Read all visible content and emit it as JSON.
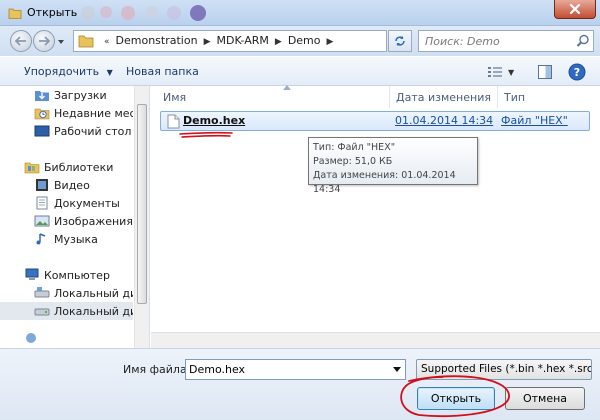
{
  "window": {
    "title": "Открыть"
  },
  "address": {
    "crumbs": [
      "Demonstration",
      "MDK-ARM",
      "Demo"
    ],
    "search_placeholder": "Поиск: Demo"
  },
  "toolbar": {
    "organize_label": "Упорядочить",
    "new_folder_label": "Новая папка"
  },
  "sidebar": {
    "items": [
      {
        "label": "Загрузки",
        "icon": "downloads-icon"
      },
      {
        "label": "Недавние места",
        "icon": "recent-places-icon"
      },
      {
        "label": "Рабочий стол",
        "icon": "desktop-icon"
      },
      {
        "label": "Библиотеки",
        "icon": "libraries-icon"
      },
      {
        "label": "Видео",
        "icon": "video-icon"
      },
      {
        "label": "Документы",
        "icon": "documents-icon"
      },
      {
        "label": "Изображения",
        "icon": "pictures-icon"
      },
      {
        "label": "Музыка",
        "icon": "music-icon"
      },
      {
        "label": "Компьютер",
        "icon": "computer-icon"
      },
      {
        "label": "Локальный диск",
        "icon": "drive-icon"
      },
      {
        "label": "Локальный диск",
        "icon": "drive-icon",
        "selected": true
      }
    ]
  },
  "file_list": {
    "columns": [
      "Имя",
      "Дата изменения",
      "Тип"
    ],
    "files": [
      {
        "name": "Demo.hex",
        "date": "01.04.2014 14:34",
        "type": "Файл \"HEX\""
      }
    ],
    "tooltip": {
      "type": "Тип: Файл \"HEX\"",
      "size": "Размер: 51,0 КБ",
      "date": "Дата изменения: 01.04.2014 14:34"
    }
  },
  "bottom": {
    "filename_label": "Имя файла:",
    "filename_value": "Demo.hex",
    "filter_label": "Supported Files (*.bin *.hex *.src",
    "open_label": "Открыть",
    "cancel_label": "Отмена"
  },
  "colors": {
    "annotation_red": "#d0101a",
    "selection_border": "#84acdd",
    "link_blue": "#1b4f9c"
  }
}
